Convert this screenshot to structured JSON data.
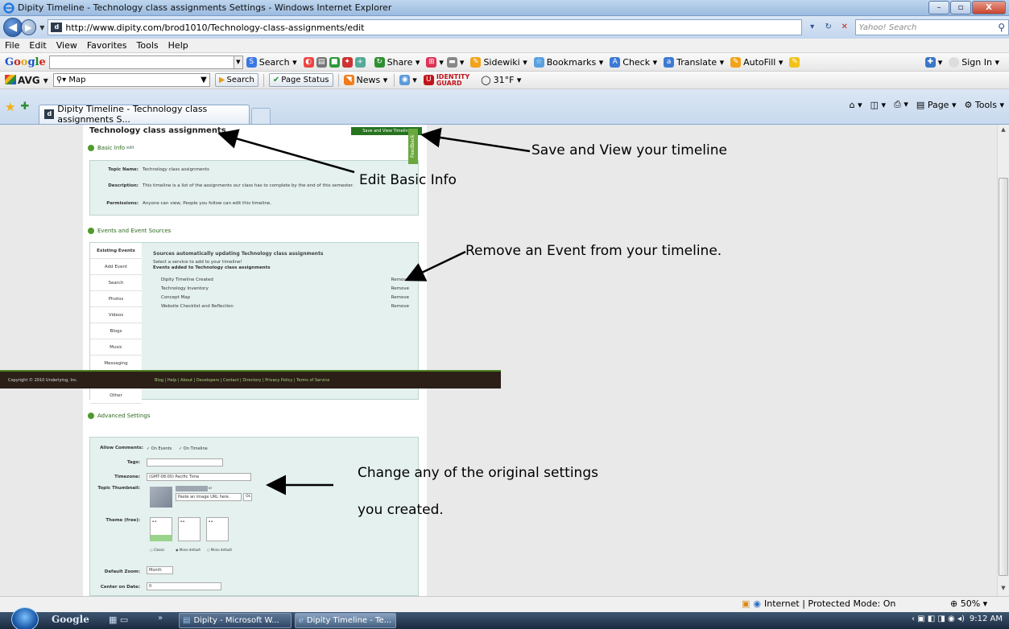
{
  "window": {
    "title": "Dipity Timeline - Technology class assignments Settings - Windows Internet Explorer",
    "buttons": {
      "minimize": "–",
      "maximize": "▫",
      "close": "X"
    }
  },
  "address": {
    "url": "http://www.dipity.com/brod1010/Technology-class-assignments/edit",
    "search_placeholder": "Yahoo! Search"
  },
  "menu": [
    "File",
    "Edit",
    "View",
    "Favorites",
    "Tools",
    "Help"
  ],
  "google_toolbar": {
    "logo": "Google",
    "search_label": "Search",
    "share_label": "Share",
    "sidewiki_label": "Sidewiki",
    "bookmarks_label": "Bookmarks",
    "check_label": "Check",
    "translate_label": "Translate",
    "autofill_label": "AutoFill",
    "signin_label": "Sign In"
  },
  "avg_toolbar": {
    "logo": "AVG",
    "search_value": "Map",
    "search_button": "Search",
    "page_status": "Page Status",
    "news": "News",
    "identity_guard_1": "IDENTITY",
    "identity_guard_2": "GUARD",
    "weather": "31°F"
  },
  "tabs": {
    "active_tab": "Dipity Timeline - Technology class assignments S...",
    "page_label": "Page",
    "tools_label": "Tools"
  },
  "page": {
    "title": "Technology class assignments",
    "save_button": "Save and View Timeline",
    "feedback": "Feedback",
    "basic_info": {
      "heading": "Basic Info",
      "edit": "edit",
      "topic_label": "Topic Name:",
      "topic_value": "Technology class assignments",
      "desc_label": "Description:",
      "desc_value": "This timeline is a list of the assignments our class has to complete by the end of this semester.",
      "perm_label": "Permissions:",
      "perm_value": "Anyone can view, People you follow can edit this timeline."
    },
    "events": {
      "heading": "Events and Event Sources",
      "side_tabs": [
        "Existing Events",
        "Add Event",
        "Search",
        "Photos",
        "Videos",
        "Blogs",
        "Music",
        "Messaging",
        "",
        "Other"
      ],
      "sources_title": "Sources automatically updating Technology class assignments",
      "select_service": "Select a service to add to your timeline!",
      "events_added": "Events added to Technology class assignments",
      "items": [
        {
          "name": "Dipity Timeline Created",
          "action": "Remove"
        },
        {
          "name": "Technology Inventory",
          "action": "Remove"
        },
        {
          "name": "Concept Map",
          "action": "Remove"
        },
        {
          "name": "Website Checklist and Reflection",
          "action": "Remove"
        }
      ]
    },
    "footer": {
      "copyright": "Copyright © 2010 Underlying, Inc.",
      "links": "Blog  |  Help  |  About  |  Developers  |  Contact  |  Directory  |  Privacy Policy  |  Terms of Service"
    },
    "advanced": {
      "heading": "Advanced Settings",
      "allow_comments_label": "Allow Comments:",
      "on_events": "✓ On Events",
      "on_timeline": "✓ On Timeline",
      "tags_label": "Tags:",
      "timezone_label": "Timezone:",
      "timezone_value": "(GMT-08:00) Pacific Time",
      "thumb_label": "Topic Thumbnail:",
      "thumb_or": "or",
      "thumb_placeholder": "Paste an image URL here.",
      "thumb_ok": "Ok",
      "theme_label": "Theme (free):",
      "theme_classic": "Classic",
      "theme_mono": "Mono default",
      "theme_mono2": "Mono default",
      "zoom_label": "Default Zoom:",
      "zoom_value": "Month",
      "center_label": "Center on Date:",
      "center_value": "0"
    }
  },
  "annotations": {
    "save": "Save and View your timeline",
    "basic": "Edit Basic Info",
    "remove": "Remove an Event from your timeline.",
    "change1": "Change any of the original settings",
    "change2": "you created."
  },
  "status": {
    "zone": "Internet | Protected Mode: On",
    "zoom": "50%"
  },
  "taskbar": {
    "google": "Google",
    "task1": "Dipity - Microsoft W...",
    "task2": "Dipity Timeline - Te...",
    "clock": "9:12 AM"
  },
  "colors": {
    "save_green": "#27731f",
    "panel_bg": "#e4f1ee",
    "footer_bg": "#2b1f18"
  }
}
